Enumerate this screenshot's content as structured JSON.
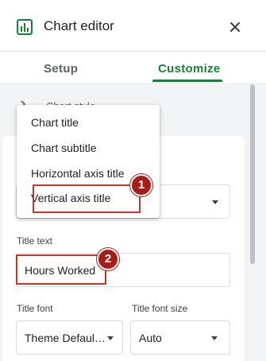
{
  "header": {
    "title": "Chart editor"
  },
  "tabs": [
    {
      "label": "Setup"
    },
    {
      "label": "Customize"
    }
  ],
  "section": {
    "peek_label": "Chart style"
  },
  "menu": {
    "items": [
      {
        "label": "Chart title"
      },
      {
        "label": "Chart subtitle"
      },
      {
        "label": "Horizontal axis title"
      },
      {
        "label": "Vertical axis title"
      }
    ]
  },
  "fields": {
    "title_text_label": "Title text",
    "title_text_value": "Hours Worked",
    "title_font_label": "Title font",
    "title_font_value": "Theme Defaul…",
    "title_font_size_label": "Title font size",
    "title_font_size_value": "Auto"
  },
  "annotations": {
    "badge_1": "1",
    "badge_2": "2"
  },
  "colors": {
    "accent": "#188038",
    "highlight": "#c0392b",
    "badge": "#a51d16"
  }
}
